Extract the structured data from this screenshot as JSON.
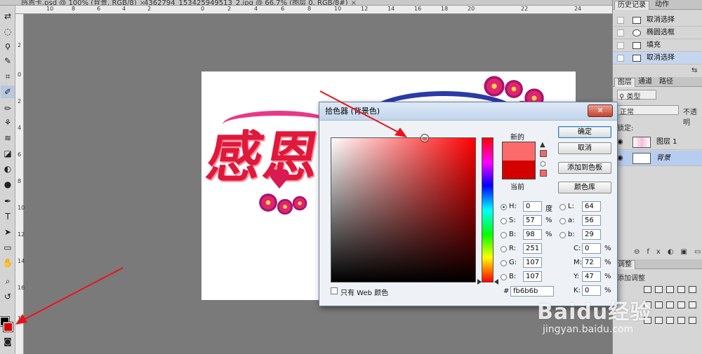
{
  "tabs": [
    {
      "label": "感恩卡.psd @ 100% (背景, RGB/8)"
    },
    {
      "label": "4362794_153425949513_2.jpg @ 66.7% (图层 0, RGB/8#)"
    }
  ],
  "ruler": {
    "h_ticks": [
      "10",
      "8",
      "6",
      "4",
      "2",
      "0",
      "2",
      "4",
      "6",
      "8",
      "10",
      "12",
      "14",
      "16",
      "18",
      "20",
      "22",
      "24"
    ],
    "v_ticks": [
      "2",
      "0",
      "2",
      "4",
      "6",
      "8",
      "10",
      "12",
      "14",
      "16",
      "1"
    ]
  },
  "tools": {
    "glyphs": [
      "⇄",
      "◌",
      "ϙ",
      "✎",
      "⌗",
      "✐",
      "✏",
      "⚘",
      "≋",
      "◪",
      "◐",
      "●",
      "✒",
      "T",
      "➤",
      "▭",
      "✋",
      "⌕",
      "↺"
    ],
    "foreground_color": "#000000",
    "background_color": "#d40000"
  },
  "artwork": {
    "title": "感恩",
    "heart": "♥"
  },
  "history_panel": {
    "tabs": [
      "历史记录",
      "动作"
    ],
    "items": [
      {
        "label": "取消选择",
        "selected": false
      },
      {
        "label": "椭圆选框",
        "selected": false
      },
      {
        "label": "填充",
        "selected": false
      },
      {
        "label": "取消选择",
        "selected": true
      }
    ]
  },
  "layers_panel": {
    "tabs": [
      "图层",
      "通道",
      "路径"
    ],
    "filter_label": "类型",
    "blend_mode": "正常",
    "opacity_label": "不透明",
    "lock_label": "锁定:",
    "layers": [
      {
        "name": "图层 1",
        "selected": false
      },
      {
        "name": "背景",
        "selected": true
      }
    ]
  },
  "adjustments_panel": {
    "tab": "调整",
    "add_label": "添加调整"
  },
  "color_picker": {
    "title": "拾色器 (背景色)",
    "new_label": "新的",
    "current_label": "当前",
    "new_color": "#fb6b6b",
    "current_color": "#d40000",
    "buttons": {
      "ok": "确定",
      "cancel": "取消",
      "add_swatch": "添加到色板",
      "libraries": "颜色库"
    },
    "hsb": [
      {
        "label": "H:",
        "value": "0",
        "unit": "度",
        "selected": true
      },
      {
        "label": "S:",
        "value": "57",
        "unit": "%",
        "selected": false
      },
      {
        "label": "B:",
        "value": "98",
        "unit": "%",
        "selected": false
      }
    ],
    "rgb": [
      {
        "label": "R:",
        "value": "251"
      },
      {
        "label": "G:",
        "value": "107"
      },
      {
        "label": "B:",
        "value": "107"
      }
    ],
    "lab": [
      {
        "label": "L:",
        "value": "64"
      },
      {
        "label": "a:",
        "value": "56"
      },
      {
        "label": "b:",
        "value": "29"
      }
    ],
    "cmyk": [
      {
        "label": "C:",
        "value": "0",
        "unit": "%"
      },
      {
        "label": "M:",
        "value": "72",
        "unit": "%"
      },
      {
        "label": "Y:",
        "value": "47",
        "unit": "%"
      },
      {
        "label": "K:",
        "value": "0",
        "unit": "%"
      }
    ],
    "hex_label": "#",
    "hex_value": "fb6b6b",
    "web_only_label": "只有 Web 颜色"
  },
  "watermark": {
    "logo": "Baidu经验",
    "url": "jingyan.baidu.com"
  }
}
